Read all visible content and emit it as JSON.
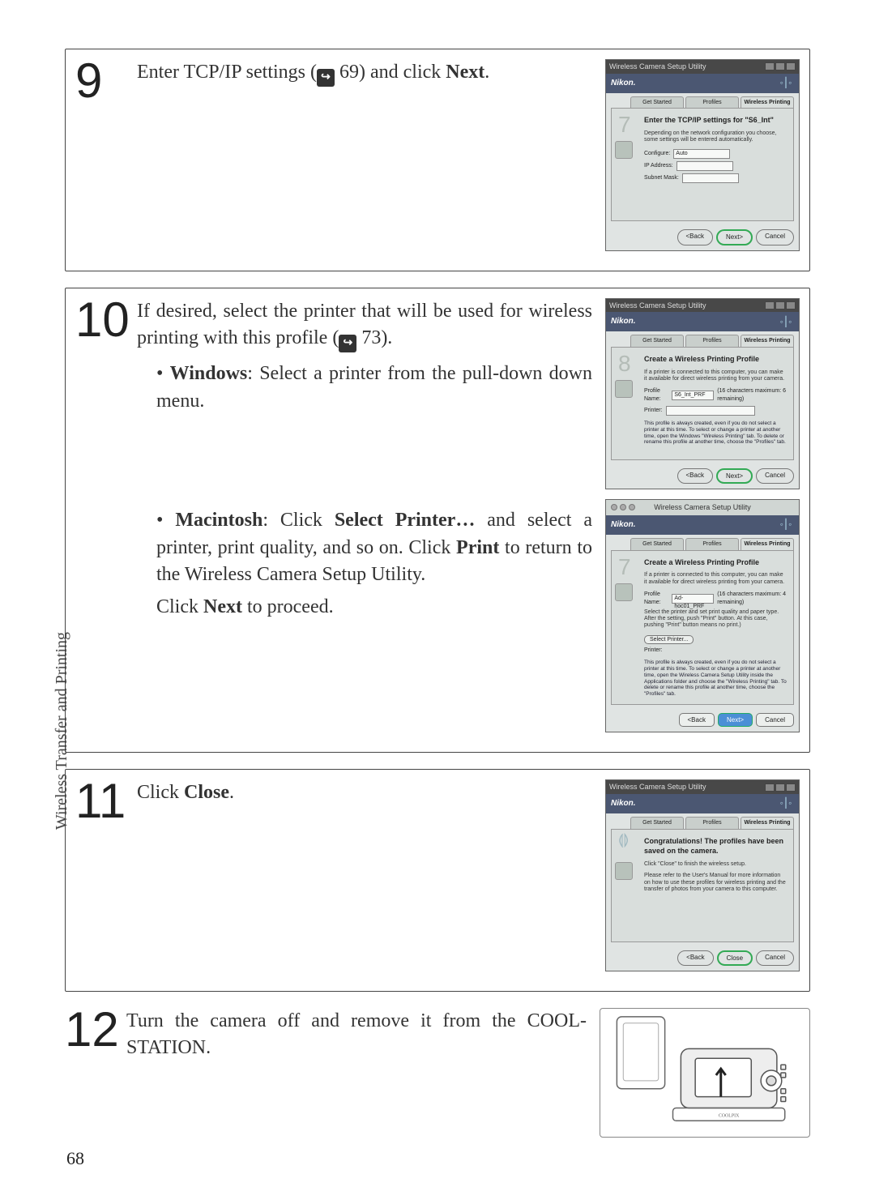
{
  "sidebar_label": "Wireless Transfer and Printing",
  "page_number": "68",
  "xref_icon_glyph": "↪",
  "steps": {
    "s9": {
      "num": "9",
      "text_before": "Enter TCP/IP settings (",
      "xref": "69",
      "text_after": ") and click ",
      "text_bold": "Next",
      "text_end": ".",
      "dlg": {
        "title": "Wireless Camera Setup Utility",
        "brand": "Nikon.",
        "tabs": [
          "Get Started",
          "Profiles",
          "Wireless Printing"
        ],
        "sidenum": "7",
        "heading": "Enter the TCP/IP settings for \"S6_Int\"",
        "sub": "Depending on the network configuration you choose, some settings will be entered automatically.",
        "rows": [
          {
            "label": "Configure:",
            "value": "Auto"
          },
          {
            "label": "IP Address:",
            "value": ""
          },
          {
            "label": "Subnet Mask:",
            "value": ""
          }
        ],
        "buttons": {
          "back": "<Back",
          "next": "Next>",
          "cancel": "Cancel"
        }
      }
    },
    "s10": {
      "num": "10",
      "text_before": "If desired, select the printer that will be used for wireless printing with this profile (",
      "xref": "73",
      "text_after": ").",
      "win_bold": "Windows",
      "win_text": ": Select a printer from the pull-down down menu.",
      "mac_bold1": "Macintosh",
      "mac_text1": ":  Click ",
      "mac_bold2": "Select Printer…",
      "mac_text2": " and select a printer, print quality, and so on.  Click ",
      "mac_bold3": "Print",
      "mac_text3": " to return to the Wireless Camera Setup Utility.",
      "mac_next_before": "Click ",
      "mac_next_bold": "Next",
      "mac_next_after": " to proceed.",
      "dlg_win": {
        "title": "Wireless Camera Setup Utility",
        "brand": "Nikon.",
        "tabs": [
          "Get Started",
          "Profiles",
          "Wireless Printing"
        ],
        "sidenum": "8",
        "heading": "Create a Wireless Printing Profile",
        "sub": "If a printer is connected to this computer, you can make it available for direct wireless printing from your camera.",
        "profile_label": "Profile Name:",
        "profile_value": "S6_Int_PRF",
        "profile_hint": "(16 characters maximum: 6 remaining)",
        "printer_label": "Printer:",
        "note": "This profile is always created, even if you do not select a printer at this time. To select or change a printer at another time, open the Windows \"Wireless Printing\" tab. To delete or rename this profile at another time, choose the \"Profiles\" tab.",
        "buttons": {
          "back": "<Back",
          "next": "Next>",
          "cancel": "Cancel"
        }
      },
      "dlg_mac": {
        "title": "Wireless Camera Setup Utility",
        "brand": "Nikon.",
        "tabs": [
          "Get Started",
          "Profiles",
          "Wireless Printing"
        ],
        "sidenum": "7",
        "heading": "Create a Wireless Printing Profile",
        "sub": "If a printer is connected to this computer, you can make it available for direct wireless printing from your camera.",
        "profile_label": "Profile Name:",
        "profile_value": "Ad-hoc01_PRF",
        "profile_hint": "(16 characters maximum: 4 remaining)",
        "select_text": "Select the printer and set print quality and paper type. After the setting, push \"Print\" button. At this case, pushing \"Print\" button means no print.)",
        "select_btn": "Select Printer...",
        "printer_label": "Printer:",
        "note": "This profile is always created, even if you do not select a printer at this time. To select or change a printer at another time, open the Wireless Camera Setup Utility inside the Applications folder and choose the \"Wireless Printing\" tab. To delete or rename this profile at another time, choose the \"Profiles\" tab.",
        "buttons": {
          "back": "<Back",
          "next": "Next>",
          "cancel": "Cancel"
        }
      }
    },
    "s11": {
      "num": "11",
      "text_before": "Click ",
      "text_bold": "Close",
      "text_after": ".",
      "dlg": {
        "title": "Wireless Camera Setup Utility",
        "brand": "Nikon.",
        "tabs": [
          "Get Started",
          "Profiles",
          "Wireless Printing"
        ],
        "sidenum": "",
        "heading": "Congratulations! The profiles have been saved on the camera.",
        "sub1": "Click \"Close\" to finish the wireless setup.",
        "sub2": "Please refer to the User's Manual for more information on how to use these profiles for wireless printing and the transfer of photos from your camera to this computer.",
        "buttons": {
          "back": "<Back",
          "close": "Close",
          "cancel": "Cancel"
        }
      }
    },
    "s12": {
      "num": "12",
      "text": "Turn the camera off and remove it from the COOL-STATION."
    }
  }
}
